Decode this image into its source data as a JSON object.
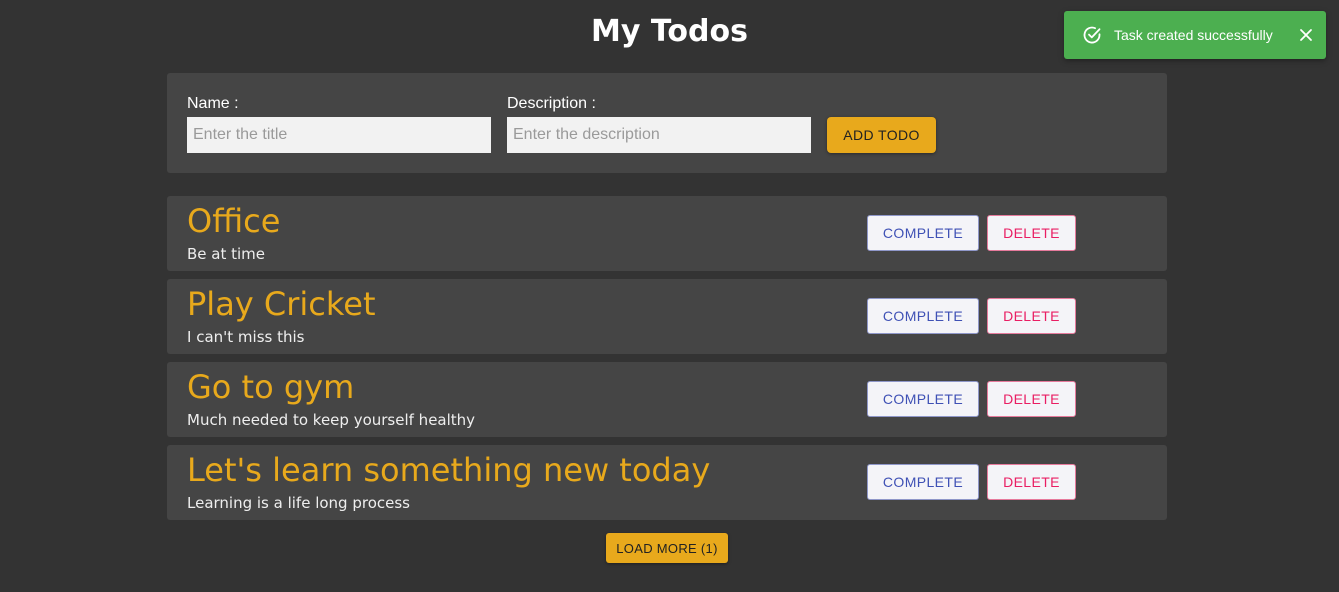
{
  "header": {
    "title": "My Todos"
  },
  "form": {
    "name_label": "Name :",
    "name_placeholder": "Enter the title",
    "name_value": "",
    "description_label": "Description :",
    "description_placeholder": "Enter the description",
    "description_value": "",
    "add_button_label": "ADD TODO"
  },
  "todos": [
    {
      "title": "Office",
      "description": "Be at time",
      "complete_label": "COMPLETE",
      "delete_label": "DELETE"
    },
    {
      "title": "Play Cricket",
      "description": "I can't miss this",
      "complete_label": "COMPLETE",
      "delete_label": "DELETE"
    },
    {
      "title": "Go to gym",
      "description": "Much needed to keep yourself healthy",
      "complete_label": "COMPLETE",
      "delete_label": "DELETE"
    },
    {
      "title": "Let's learn something new today",
      "description": "Learning is a life long process",
      "complete_label": "COMPLETE",
      "delete_label": "DELETE"
    }
  ],
  "load_more": {
    "label": "LOAD MORE (1)"
  },
  "toast": {
    "message": "Task created successfully",
    "icon": "check-circle-icon",
    "close_icon": "close-icon",
    "color": "#4caf50"
  },
  "colors": {
    "background": "#333333",
    "card": "#454545",
    "accent": "#e8a91c",
    "complete": "#3f51b5",
    "delete": "#e91e63",
    "success": "#4caf50"
  }
}
